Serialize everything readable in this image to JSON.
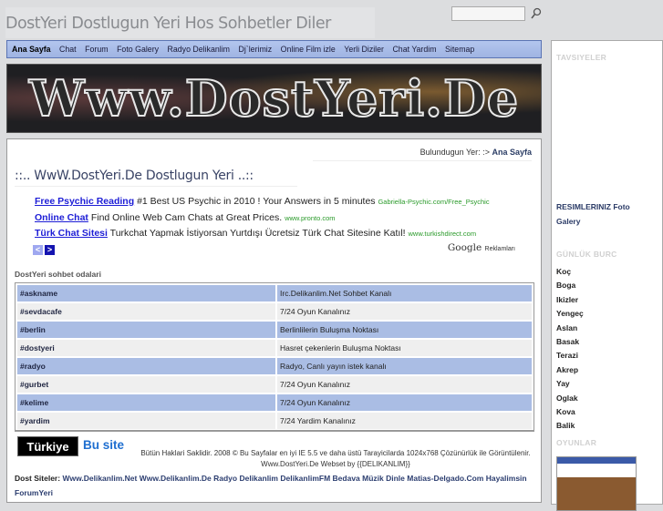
{
  "header": {
    "title": "DostYeri  Dostlugun Yeri Hos Sohbetler Diler",
    "search_placeholder": ""
  },
  "nav": [
    "Ana Sayfa",
    "Chat",
    "Forum",
    "Foto Galery",
    "Radyo Delikanlim",
    "Dj`lerimiz",
    "Online Film izle",
    "Yerli Diziler",
    "Chat Yardim",
    "Sitemap"
  ],
  "banner": {
    "text": "Www.DostYeri.De"
  },
  "breadcrumb": {
    "label": "Bulundugun Yer:",
    "arrow": ":>",
    "current": "Ana Sayfa"
  },
  "heading": "::.. WwW.DostYeri.De Dostlugun Yeri ..::",
  "ads": [
    {
      "title": "Free Psychic Reading",
      "text": "#1 Best US Psychic in 2010 ! Your Answers in 5 minutes",
      "url": "Gabriella-Psychic.com/Free_Psychic"
    },
    {
      "title": "Online Chat",
      "text": "Find Online Web Cam Chats at Great Prices.",
      "url": "www.pronto.com"
    },
    {
      "title": "Türk Chat Sitesi",
      "text": "Turkchat Yapmak İstiyorsan Yurtdışı Ücretsiz Türk Chat Sitesine Katıl!",
      "url": "www.turkishdirect.com"
    }
  ],
  "ad_nav": {
    "prev": "<",
    "next": ">"
  },
  "google": {
    "brand": "Google",
    "label": "Reklamları"
  },
  "rooms": {
    "label": "DostYeri sohbet odalari",
    "rows": [
      {
        "name": "#askname",
        "desc": "Irc.Delikanlim.Net Sohbet Kanalı"
      },
      {
        "name": "#sevdacafe",
        "desc": "7/24 Oyun Kanalınız"
      },
      {
        "name": "#berlin",
        "desc": "Berlinlilerin Buluşma Noktası"
      },
      {
        "name": "#dostyeri",
        "desc": "Hasret çekenlerin Buluşma Noktası"
      },
      {
        "name": "#radyo",
        "desc": "Radyo, Canlı yayın istek kanalı"
      },
      {
        "name": "#gurbet",
        "desc": "7/24 Oyun Kanalınız"
      },
      {
        "name": "#kelime",
        "desc": "7/24 Oyun Kanalınız"
      },
      {
        "name": "#yardim",
        "desc": "7/24 Yardim Kanalınız"
      }
    ]
  },
  "footer": {
    "badge": "Türkiye",
    "busite": "Bu site",
    "copyright": "Bütün Haklari Saklidir. 2008 © Bu Sayfalar en iyi IE 5.5 ve daha üstü Tarayicilarda 1024x768 Çözünürlük ile Görüntülenir. Www.DostYeri.De Webset by {{DELIKANLIM}}",
    "dost_label": "Dost Siteler:",
    "dost_links": [
      "Www.Delikanlim.Net",
      "Www.Delikanlim.De",
      "Radyo Delikanlim",
      "DelikanlimFM",
      "Bedava Müzik Dinle",
      "Matias-Delgado.Com",
      "Hayalimsin ForumYeri"
    ]
  },
  "sidebar": {
    "tavsiyeler": "TAVSIYELER",
    "resimler": "RESIMLERINIZ Foto Galery",
    "burc_title": "GÜNLÜK BURC",
    "burclar": [
      "Koç",
      "Boga",
      "Ikizler",
      "Yengeç",
      "Aslan",
      "Basak",
      "Terazi",
      "Akrep",
      "Yay",
      "Oglak",
      "Kova",
      "Balik"
    ],
    "oyunlar": "OYUNLAR"
  }
}
